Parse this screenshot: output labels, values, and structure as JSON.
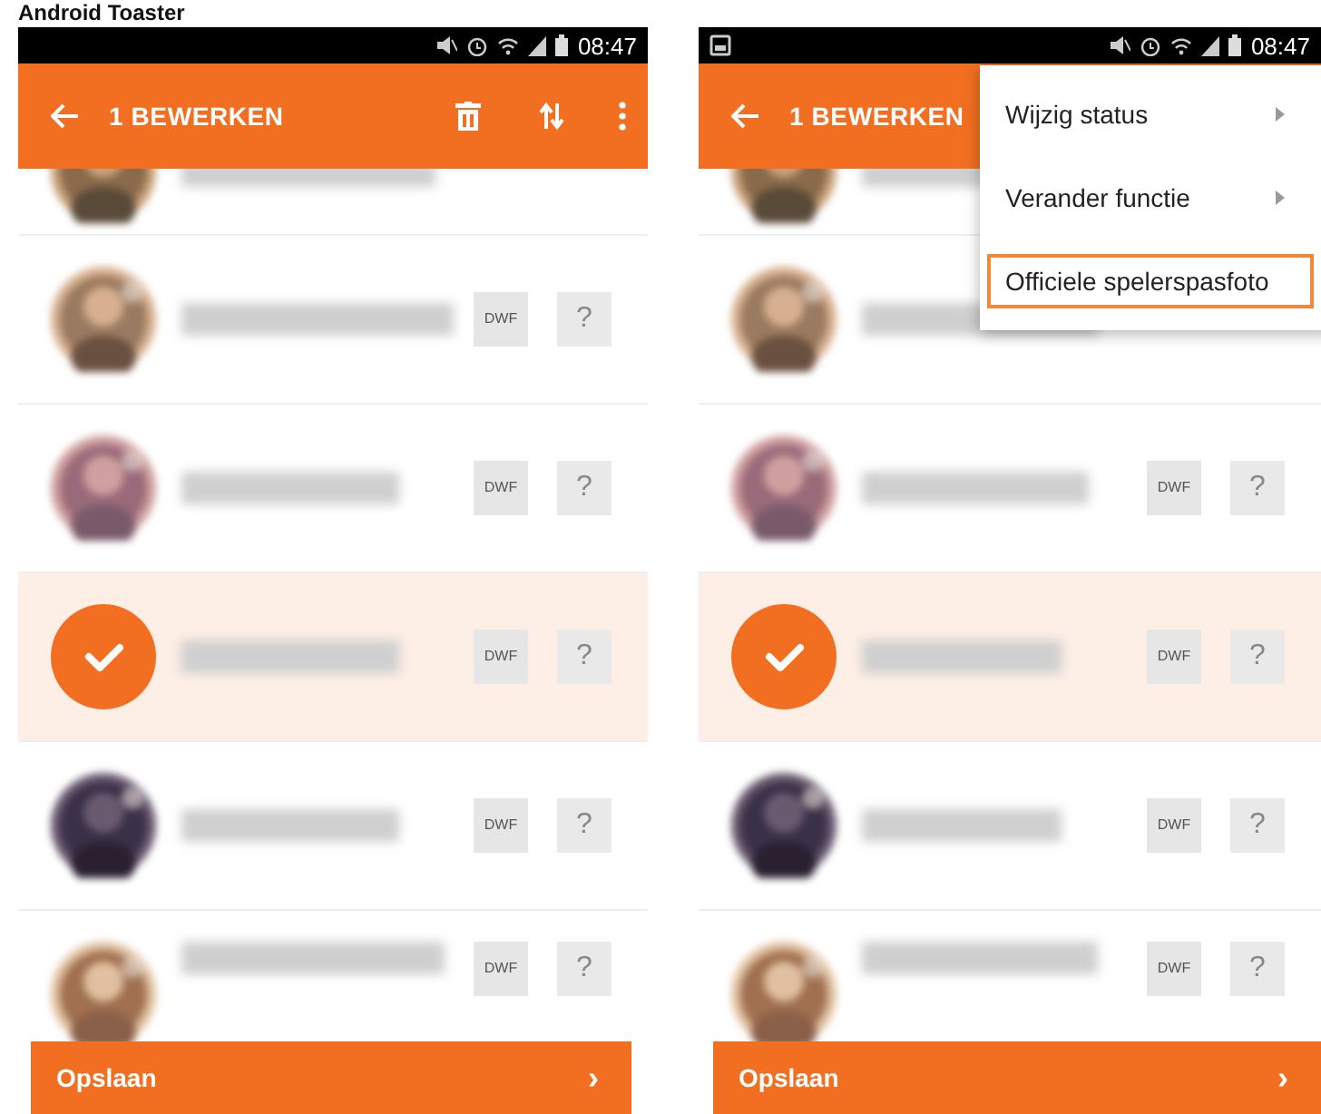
{
  "page_title": "Android Toaster",
  "phones": [
    {
      "status_bar": {
        "time": "08:47",
        "image_notification": false
      },
      "toolbar": {
        "title": "1 BEWERKEN",
        "action_icons": true
      },
      "rows": [
        {
          "kind": "partial",
          "selected": false
        },
        {
          "kind": "member",
          "selected": false,
          "tag": "DWF",
          "help": "?"
        },
        {
          "kind": "member",
          "selected": false,
          "tag": "DWF",
          "help": "?"
        },
        {
          "kind": "member",
          "selected": true,
          "tag": "DWF",
          "help": "?"
        },
        {
          "kind": "member",
          "selected": false,
          "tag": "DWF",
          "help": "?"
        },
        {
          "kind": "member",
          "selected": false,
          "tag": "DWF",
          "help": "?"
        }
      ],
      "save_button": {
        "label": "Opslaan",
        "chevron": "›"
      }
    },
    {
      "status_bar": {
        "time": "08:47",
        "image_notification": true
      },
      "toolbar": {
        "title": "1 BEWERKEN"
      },
      "rows": [
        {
          "kind": "partial",
          "selected": false
        },
        {
          "kind": "member",
          "selected": false
        },
        {
          "kind": "member",
          "selected": false,
          "tag": "DWF",
          "help": "?"
        },
        {
          "kind": "member",
          "selected": true,
          "tag": "DWF",
          "help": "?"
        },
        {
          "kind": "member",
          "selected": false,
          "tag": "DWF",
          "help": "?"
        },
        {
          "kind": "member",
          "selected": false,
          "tag": "DWF",
          "help": "?"
        }
      ],
      "menu": [
        {
          "label": "Wijzig status",
          "submenu": true,
          "highlighted": false
        },
        {
          "label": "Verander functie",
          "submenu": true,
          "highlighted": false
        },
        {
          "label": "Officiele spelerspasfoto",
          "submenu": false,
          "highlighted": true
        }
      ],
      "save_button": {
        "label": "Opslaan",
        "chevron": "›"
      }
    }
  ]
}
